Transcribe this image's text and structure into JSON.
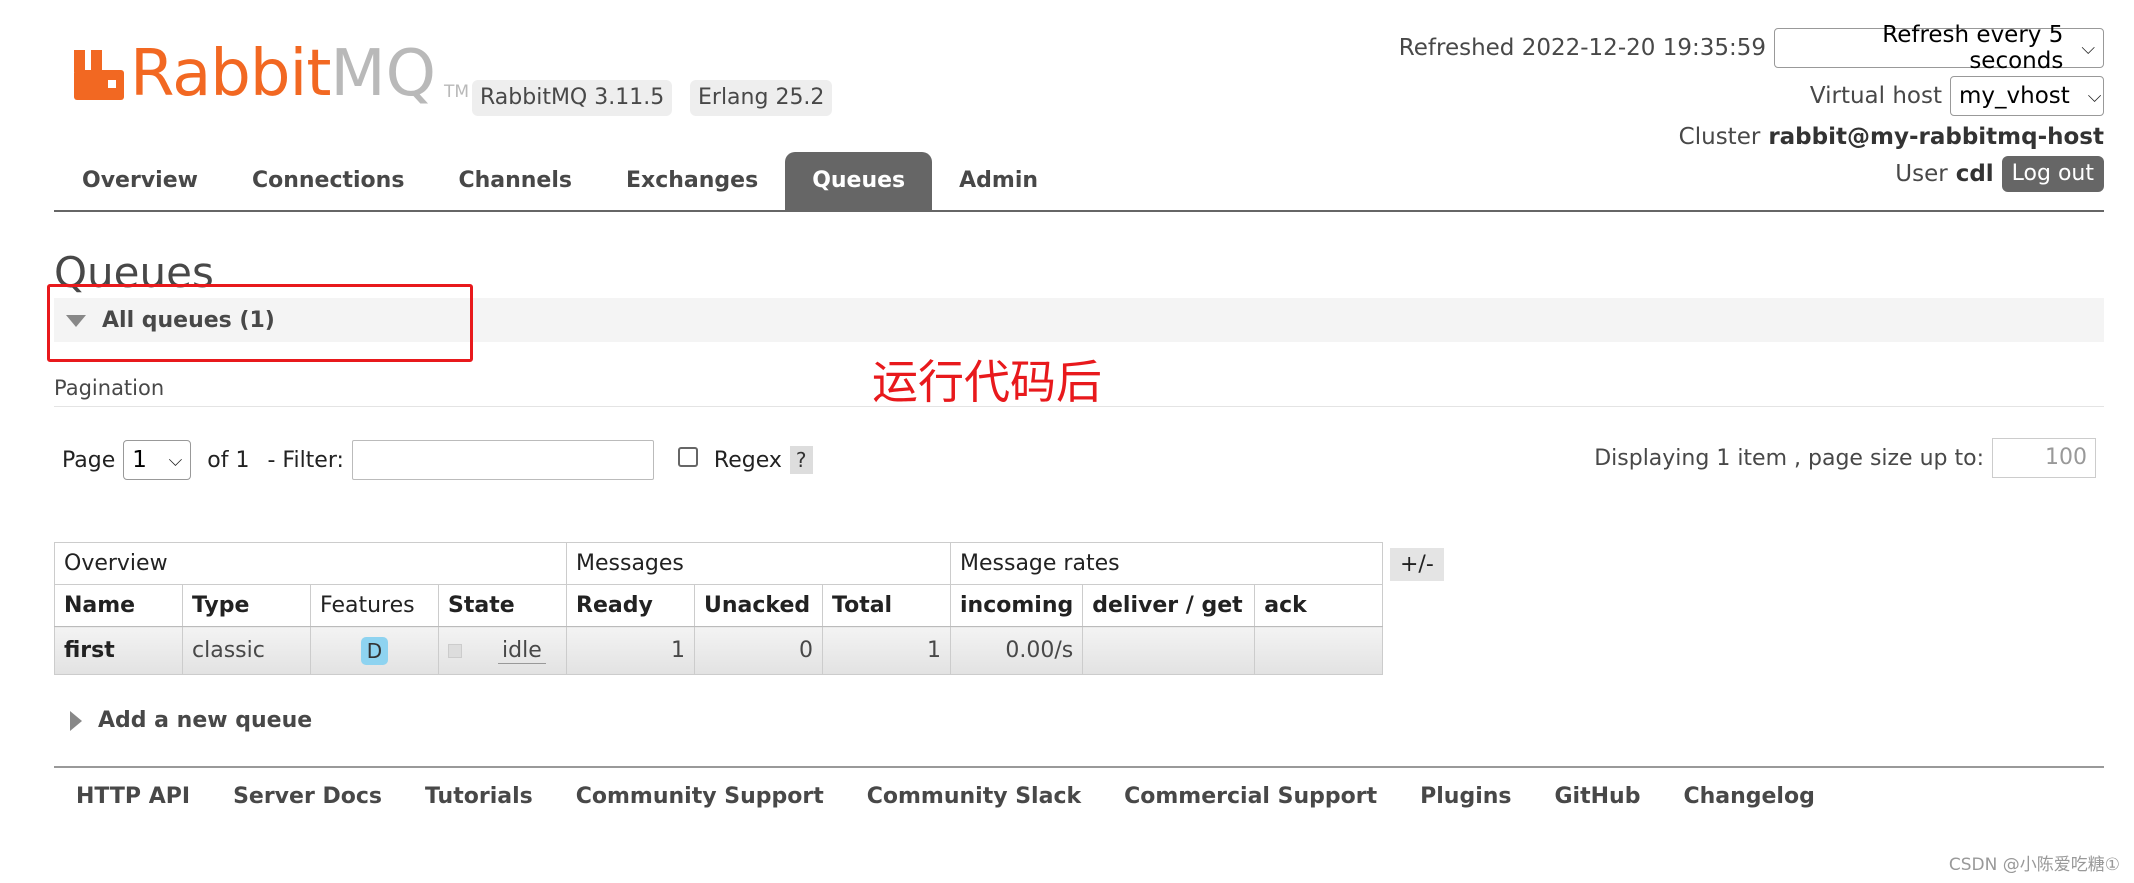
{
  "header": {
    "brand_left": "Rabbit",
    "brand_right": "MQ",
    "trademark": "TM",
    "version": "RabbitMQ 3.11.5",
    "erlang": "Erlang 25.2",
    "refreshed": "Refreshed 2022-12-20 19:35:59",
    "refresh_option": "Refresh every 5 seconds",
    "vhost_label": "Virtual host",
    "vhost_value": "my_vhost",
    "cluster_label": "Cluster",
    "cluster_value": "rabbit@my-rabbitmq-host",
    "user_label": "User",
    "user_value": "cdl",
    "logout": "Log out",
    "colors": {
      "brand": "#f26822",
      "brand_gray": "#b9b9b9",
      "tab_active": "#666666"
    }
  },
  "tabs": [
    {
      "label": "Overview"
    },
    {
      "label": "Connections"
    },
    {
      "label": "Channels"
    },
    {
      "label": "Exchanges"
    },
    {
      "label": "Queues",
      "active": true
    },
    {
      "label": "Admin"
    }
  ],
  "page": {
    "title": "Queues",
    "section": "All queues (1)",
    "annotation": "运行代码后",
    "pagination_label": "Pagination",
    "page_label": "Page",
    "page_value": "1",
    "of_label": "of 1",
    "filter_label": "- Filter:",
    "regex_label": "Regex",
    "help": "?",
    "display_info": "Displaying 1 item , page size up to:",
    "page_size": "100"
  },
  "table": {
    "groups": [
      "Overview",
      "Messages",
      "Message rates"
    ],
    "columns": [
      "Name",
      "Type",
      "Features",
      "State",
      "Ready",
      "Unacked",
      "Total",
      "incoming",
      "deliver / get",
      "ack"
    ],
    "rows": [
      {
        "name": "first",
        "type": "classic",
        "features": "D",
        "state": "idle",
        "ready": "1",
        "unacked": "0",
        "total": "1",
        "incoming": "0.00/s",
        "deliver_get": "",
        "ack": ""
      }
    ],
    "col_toggle": "+/-"
  },
  "add_queue": "Add a new queue",
  "footer": [
    "HTTP API",
    "Server Docs",
    "Tutorials",
    "Community Support",
    "Community Slack",
    "Commercial Support",
    "Plugins",
    "GitHub",
    "Changelog"
  ],
  "watermark": "CSDN @小陈爱吃糖①"
}
